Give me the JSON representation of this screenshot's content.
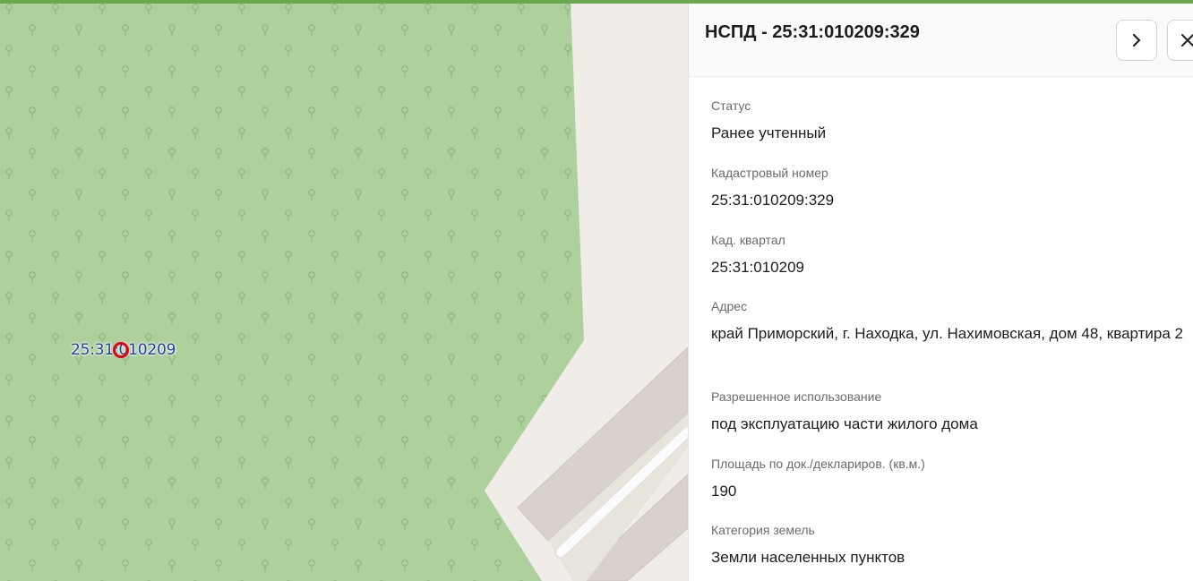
{
  "map": {
    "parcel_label": "25:31:010209",
    "colors": {
      "forest": "#aed09c",
      "tree": "#8fba7f",
      "ground": "#f0ede8",
      "building": "#d9d1cb",
      "road": "#f7f7f7"
    }
  },
  "panel": {
    "title": "НСПД - 25:31:010209:329",
    "next_icon": "chevron-right-icon",
    "close_icon": "close-icon",
    "fields": [
      {
        "label": "Статус",
        "value": "Ранее учтенный"
      },
      {
        "label": "Кадастровый номер",
        "value": "25:31:010209:329"
      },
      {
        "label": "Кад. квартал",
        "value": "25:31:010209"
      },
      {
        "label": "Адрес",
        "value": "край Приморский, г. Находка, ул. Нахимовская, дом 48, квартира 2"
      },
      {
        "label": "Разрешенное использование",
        "value": "под эксплуатацию части жилого дома"
      },
      {
        "label": "Площадь по док./деклариров. (кв.м.)",
        "value": "190"
      },
      {
        "label": "Категория земель",
        "value": "Земли населенных пунктов"
      }
    ]
  }
}
